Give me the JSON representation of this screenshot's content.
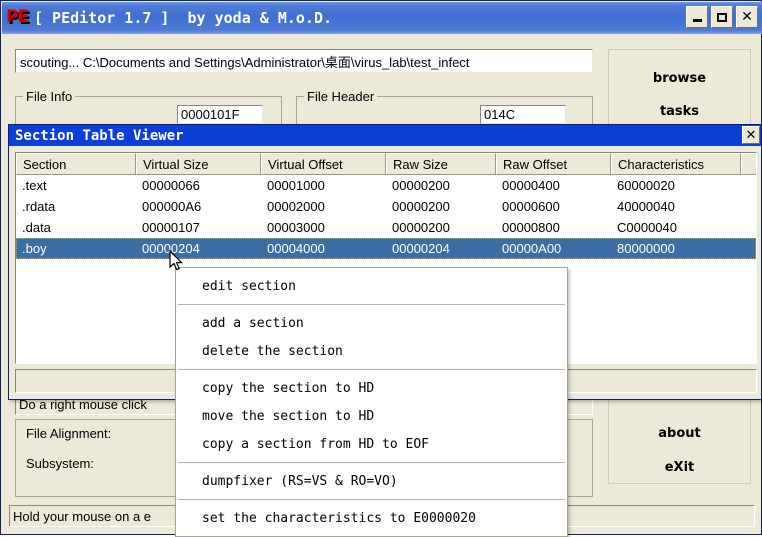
{
  "window": {
    "title": "[ PEditor 1.7 ]  by yoda & M.o.D.",
    "icon": "PE",
    "minimize_label": "_",
    "maximize_label": "□",
    "close_label": "✕"
  },
  "path_field": {
    "value": "scouting... C:\\Documents and Settings\\Administrator\\桌面\\virus_lab\\test_infect"
  },
  "groups": {
    "file_info": {
      "label": "File Info",
      "value": "0000101F"
    },
    "file_header": {
      "label": "File Header",
      "value": "014C"
    },
    "file_alignment_label": "File Alignment:",
    "subsystem_label": "Subsystem:"
  },
  "side_buttons": {
    "browse": "browse",
    "tasks": "tasks",
    "about": "about",
    "exit": "eXit"
  },
  "status_bars": {
    "primary": "Do a right mouse click",
    "secondary": "Hold your mouse on a e"
  },
  "section_viewer": {
    "title": "Section Table Viewer",
    "close_label": "✕",
    "columns": [
      "Section",
      "Virtual Size",
      "Virtual Offset",
      "Raw Size",
      "Raw Offset",
      "Characteristics"
    ],
    "rows": [
      {
        "section": ".text",
        "virtual_size": "00000066",
        "virtual_offset": "00001000",
        "raw_size": "00000200",
        "raw_offset": "00000400",
        "characteristics": "60000020",
        "selected": false
      },
      {
        "section": ".rdata",
        "virtual_size": "000000A6",
        "virtual_offset": "00002000",
        "raw_size": "00000200",
        "raw_offset": "00000600",
        "characteristics": "40000040",
        "selected": false
      },
      {
        "section": ".data",
        "virtual_size": "00000107",
        "virtual_offset": "00003000",
        "raw_size": "00000200",
        "raw_offset": "00000800",
        "characteristics": "C0000040",
        "selected": false
      },
      {
        "section": ".boy",
        "virtual_size": "00000204",
        "virtual_offset": "00004000",
        "raw_size": "00000204",
        "raw_offset": "00000A00",
        "characteristics": "80000000",
        "selected": true
      }
    ],
    "status": ""
  },
  "context_menu": {
    "items": [
      {
        "label": "edit section",
        "separator_after": true
      },
      {
        "label": "add a section",
        "separator_after": false
      },
      {
        "label": "delete the section",
        "separator_after": true
      },
      {
        "label": "copy the section to HD",
        "separator_after": false
      },
      {
        "label": "move the section to HD",
        "separator_after": false
      },
      {
        "label": "copy a section from HD to EOF",
        "separator_after": true
      },
      {
        "label": "dumpfixer (RS=VS & RO=VO)",
        "separator_after": true
      },
      {
        "label": "set the characteristics to E0000020",
        "separator_after": false
      }
    ]
  },
  "colors": {
    "title_bar": "#3f6fd1",
    "stv_title_bar": "#0b3fd6",
    "selection": "#3a6ea5",
    "face": "#ece9d8",
    "icon_red": "#d40000"
  }
}
